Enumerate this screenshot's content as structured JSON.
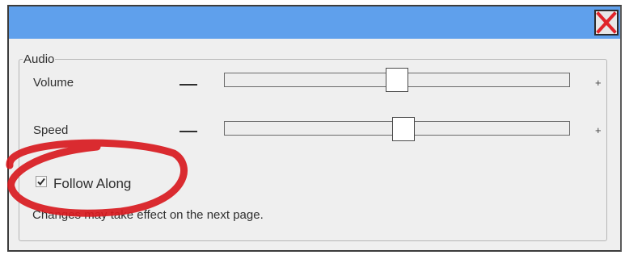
{
  "dialog": {
    "close_icon": "close-x-icon"
  },
  "audio": {
    "group_label": "Audio",
    "volume": {
      "label": "Volume",
      "minus": "—",
      "plus": "+",
      "level": 0.5
    },
    "speed": {
      "label": "Speed",
      "minus": "—",
      "plus": "+",
      "level": 0.52
    },
    "follow_along": {
      "label": "Follow Along",
      "checked": true
    },
    "note": "Changes may take effect on the next page."
  },
  "colors": {
    "titlebar": "#5fa0ec",
    "close_x": "#e0242a",
    "annotation_circle": "#d81a1f"
  }
}
